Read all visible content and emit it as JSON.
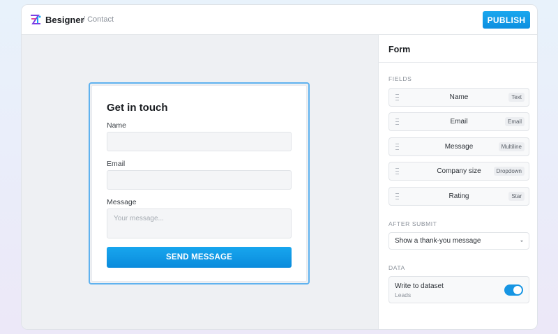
{
  "header": {
    "brand": "Besigner",
    "breadcrumb": "/ Contact",
    "publish_label": "PUBLISH"
  },
  "form": {
    "title": "Get in touch",
    "fields": [
      {
        "label": "Name",
        "value": ""
      },
      {
        "label": "Email",
        "value": ""
      },
      {
        "label": "Message",
        "placeholder": "Your message..."
      }
    ],
    "submit_label": "SEND MESSAGE"
  },
  "panel": {
    "title": "Form",
    "fields_section": "FIELDS",
    "fields": [
      {
        "name": "Name",
        "type": "Text"
      },
      {
        "name": "Email",
        "type": "Email"
      },
      {
        "name": "Message",
        "type": "Multiline"
      },
      {
        "name": "Company size",
        "type": "Dropdown"
      },
      {
        "name": "Rating",
        "type": "Star"
      }
    ],
    "after_submit_section": "AFTER SUBMIT",
    "after_submit_value": "Show a thank-you message",
    "data_section": "DATA",
    "data_title": "Write to dataset",
    "data_dataset": "Leads",
    "data_toggle_on": true
  },
  "colors": {
    "accent": "#0c8fe0",
    "selection": "#5fb2ef"
  }
}
